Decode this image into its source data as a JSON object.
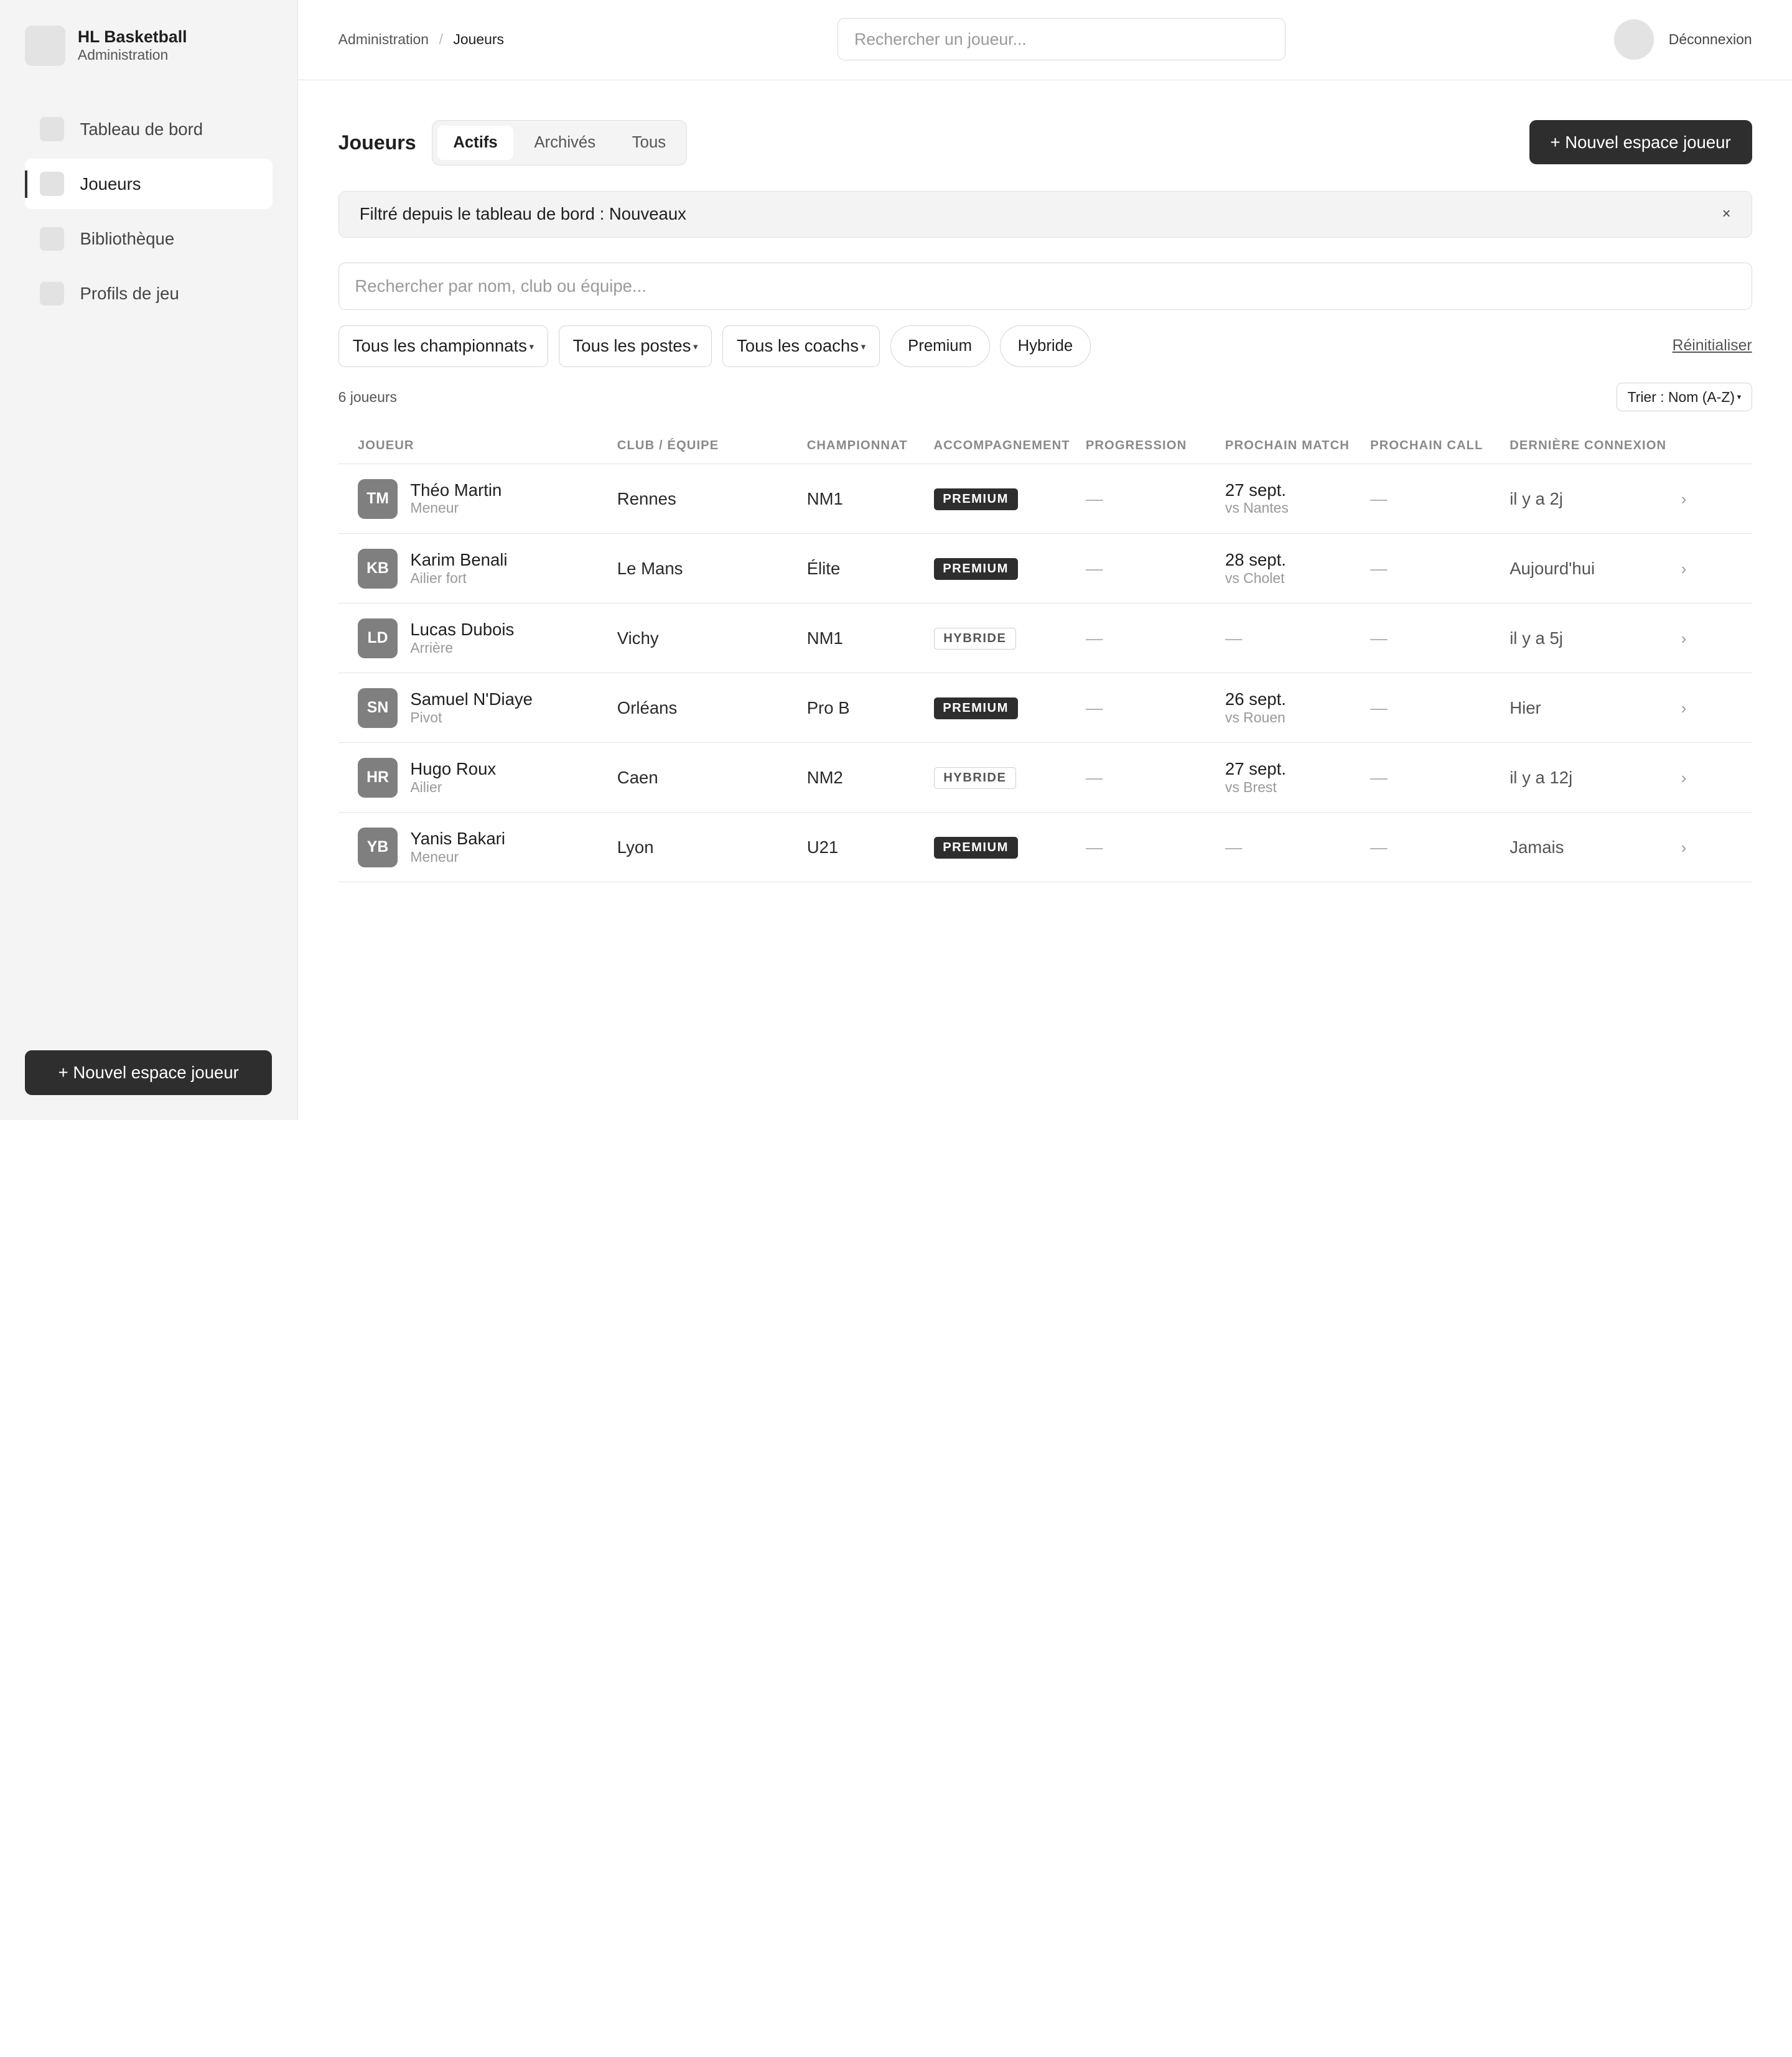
{
  "brand": {
    "title": "HL Basketball",
    "subtitle": "Administration"
  },
  "sidebar": {
    "items": [
      {
        "label": "Tableau de bord",
        "active": false
      },
      {
        "label": "Joueurs",
        "active": true
      },
      {
        "label": "Bibliothèque",
        "active": false
      },
      {
        "label": "Profils de jeu",
        "active": false
      }
    ],
    "cta_label": "+ Nouvel espace joueur"
  },
  "topbar": {
    "breadcrumb": [
      "Administration",
      "Joueurs"
    ],
    "breadcrumb_sep": "/",
    "search_placeholder": "Rechercher un joueur...",
    "logout_label": "Déconnexion"
  },
  "page": {
    "title": "Joueurs",
    "tabs": [
      {
        "label": "Actifs",
        "active": true
      },
      {
        "label": "Archivés",
        "active": false
      },
      {
        "label": "Tous",
        "active": false
      }
    ],
    "cta_label": "+ Nouvel espace joueur"
  },
  "filter_banner": {
    "text": "Filtré depuis le tableau de bord : Nouveaux",
    "close": "×"
  },
  "search": {
    "placeholder": "Rechercher par nom, club ou équipe..."
  },
  "filters": {
    "championnat": "Tous les championnats",
    "postes": "Tous les postes",
    "coachs": "Tous les coachs",
    "chips": [
      "Premium",
      "Hybride"
    ],
    "reset_label": "Réinitialiser",
    "caret": "▾"
  },
  "results": {
    "count_label": "6 joueurs",
    "sort_label": "Trier : Nom (A-Z)"
  },
  "table": {
    "headers": [
      "JOUEUR",
      "CLUB / ÉQUIPE",
      "CHAMPIONNAT",
      "ACCOMPAGNEMENT",
      "PROGRESSION",
      "PROCHAIN MATCH",
      "PROCHAIN CALL",
      "DERNIÈRE CONNEXION"
    ],
    "rows": [
      {
        "initials": "TM",
        "name": "Théo Martin",
        "role": "Meneur",
        "club": "Rennes",
        "championnat": "NM1",
        "badge": "PREMIUM",
        "badge_type": "premium",
        "progression": "—",
        "match_date": "27 sept.",
        "match_vs": "vs Nantes",
        "call": "—",
        "last": "il y a 2j",
        "chev": "›"
      },
      {
        "initials": "KB",
        "name": "Karim Benali",
        "role": "Ailier fort",
        "club": "Le Mans",
        "championnat": "Élite",
        "badge": "PREMIUM",
        "badge_type": "premium",
        "progression": "—",
        "match_date": "28 sept.",
        "match_vs": "vs Cholet",
        "call": "—",
        "last": "Aujourd'hui",
        "chev": "›"
      },
      {
        "initials": "LD",
        "name": "Lucas Dubois",
        "role": "Arrière",
        "club": "Vichy",
        "championnat": "NM1",
        "badge": "HYBRIDE",
        "badge_type": "hybride",
        "progression": "—",
        "match_date": "—",
        "match_vs": "",
        "call": "—",
        "last": "il y a 5j",
        "chev": "›"
      },
      {
        "initials": "SN",
        "name": "Samuel N'Diaye",
        "role": "Pivot",
        "club": "Orléans",
        "championnat": "Pro B",
        "badge": "PREMIUM",
        "badge_type": "premium",
        "progression": "—",
        "match_date": "26 sept.",
        "match_vs": "vs Rouen",
        "call": "—",
        "last": "Hier",
        "chev": "›"
      },
      {
        "initials": "HR",
        "name": "Hugo Roux",
        "role": "Ailier",
        "club": "Caen",
        "championnat": "NM2",
        "badge": "HYBRIDE",
        "badge_type": "hybride",
        "progression": "—",
        "match_date": "27 sept.",
        "match_vs": "vs Brest",
        "call": "—",
        "last": "il y a 12j",
        "chev": "›"
      },
      {
        "initials": "YB",
        "name": "Yanis Bakari",
        "role": "Meneur",
        "club": "Lyon",
        "championnat": "U21",
        "badge": "PREMIUM",
        "badge_type": "premium",
        "progression": "—",
        "match_date": "—",
        "match_vs": "",
        "call": "—",
        "last": "Jamais",
        "chev": "›"
      }
    ]
  },
  "colors": {
    "accent_dark": "#2e2e2e",
    "sidebar_bg": "#f4f4f4",
    "avatar_bg": "#7f7f7f"
  }
}
